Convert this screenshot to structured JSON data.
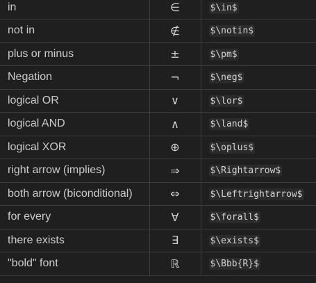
{
  "rows": [
    {
      "name": "in",
      "symbol": "∈",
      "code": "$\\in$"
    },
    {
      "name": "not in",
      "symbol": "∉",
      "code": "$\\notin$"
    },
    {
      "name": "plus or minus",
      "symbol": "±",
      "code": "$\\pm$"
    },
    {
      "name": "Negation",
      "symbol": "¬",
      "code": "$\\neg$"
    },
    {
      "name": "logical OR",
      "symbol": "∨",
      "code": "$\\lor$"
    },
    {
      "name": "logical AND",
      "symbol": "∧",
      "code": "$\\land$"
    },
    {
      "name": "logical XOR",
      "symbol": "⊕",
      "code": "$\\oplus$"
    },
    {
      "name": "right arrow (implies)",
      "symbol": "⇒",
      "code": "$\\Rightarrow$"
    },
    {
      "name": "both arrow (biconditional)",
      "symbol": "⇔",
      "code": "$\\Leftrightarrow$"
    },
    {
      "name": "for every",
      "symbol": "∀",
      "code": "$\\forall$"
    },
    {
      "name": "there exists",
      "symbol": "∃",
      "code": "$\\exists$"
    },
    {
      "name": "\"bold\" font",
      "symbol": "ℝ",
      "code": "$\\Bbb{R}$"
    }
  ]
}
